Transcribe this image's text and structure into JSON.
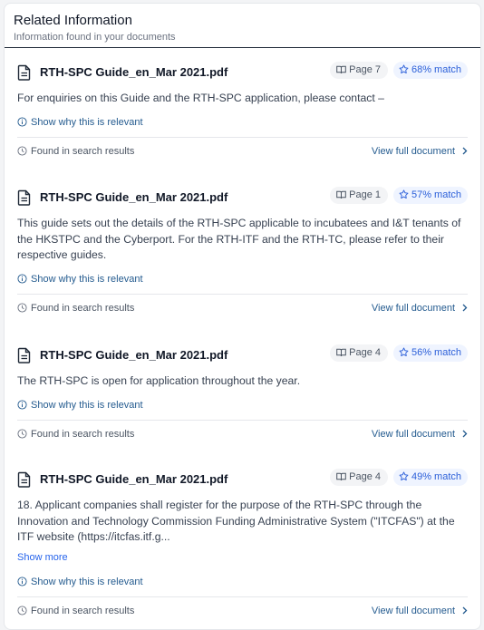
{
  "header": {
    "title": "Related Information",
    "subtitle": "Information found in your documents"
  },
  "results": [
    {
      "file": "RTH-SPC Guide_en_Mar 2021.pdf",
      "page": "Page 7",
      "match": "68% match",
      "excerpt": "For enquiries on this Guide and the RTH-SPC application, please contact –",
      "show_more": "",
      "relevance": "Show why this is relevant",
      "found": "Found in search results",
      "view": "View full document"
    },
    {
      "file": "RTH-SPC Guide_en_Mar 2021.pdf",
      "page": "Page 1",
      "match": "57% match",
      "excerpt": "This guide sets out the details of the RTH-SPC applicable to incubatees and I&T tenants of the HKSTPC and the Cyberport. For the RTH-ITF and the RTH-TC, please refer to their respective guides.",
      "show_more": "",
      "relevance": "Show why this is relevant",
      "found": "Found in search results",
      "view": "View full document"
    },
    {
      "file": "RTH-SPC Guide_en_Mar 2021.pdf",
      "page": "Page 4",
      "match": "56% match",
      "excerpt": "The RTH-SPC is open for application throughout the year.",
      "show_more": "",
      "relevance": "Show why this is relevant",
      "found": "Found in search results",
      "view": "View full document"
    },
    {
      "file": "RTH-SPC Guide_en_Mar 2021.pdf",
      "page": "Page 4",
      "match": "49% match",
      "excerpt": "18. Applicant companies shall register for the purpose of the RTH-SPC through the Innovation and Technology Commission Funding Administrative System (\"ITCFAS\") at the ITF website (https://itcfas.itf.g...",
      "show_more": "Show more",
      "relevance": "Show why this is relevant",
      "found": "Found in search results",
      "view": "View full document"
    }
  ],
  "colors": {
    "link": "#245b8f",
    "match_text": "#2b5fd9",
    "match_bg": "#eff4ff",
    "page_bg": "#f3f4f6"
  },
  "icons": {
    "file": "document-icon",
    "page": "book-icon",
    "match": "star-icon",
    "relevance": "info-icon",
    "found": "clock-icon",
    "view": "chevron-right-icon"
  }
}
